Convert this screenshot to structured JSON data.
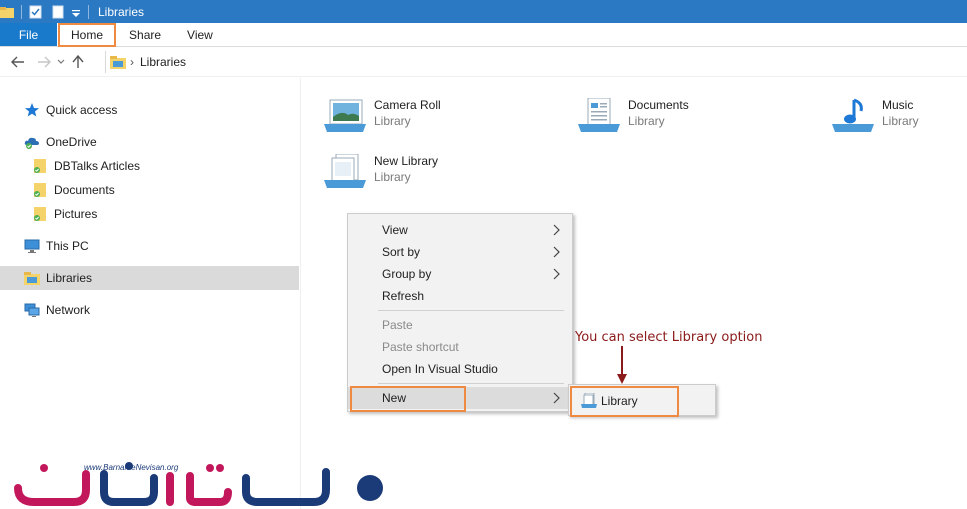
{
  "window": {
    "title": "Libraries"
  },
  "ribbon": {
    "tabs": [
      {
        "label": "File"
      },
      {
        "label": "Home"
      },
      {
        "label": "Share"
      },
      {
        "label": "View"
      }
    ]
  },
  "address": {
    "path": "Libraries"
  },
  "sidebar": {
    "items": [
      {
        "label": "Quick access",
        "icon": "star-icon"
      },
      {
        "label": "OneDrive",
        "icon": "cloud-icon"
      },
      {
        "label": "DBTalks Articles",
        "icon": "folder-icon"
      },
      {
        "label": "Documents",
        "icon": "folder-icon"
      },
      {
        "label": "Pictures",
        "icon": "folder-icon"
      },
      {
        "label": "This PC",
        "icon": "monitor-icon"
      },
      {
        "label": "Libraries",
        "icon": "library-icon"
      },
      {
        "label": "Network",
        "icon": "network-icon"
      }
    ]
  },
  "libraries": [
    {
      "name": "Camera Roll",
      "type": "Library",
      "icon": "camera-roll-library-icon"
    },
    {
      "name": "Documents",
      "type": "Library",
      "icon": "documents-library-icon"
    },
    {
      "name": "Music",
      "type": "Library",
      "icon": "music-library-icon"
    },
    {
      "name": "New Library",
      "type": "Library",
      "icon": "generic-library-icon"
    }
  ],
  "context_menu": {
    "items": [
      {
        "label": "View",
        "submenu": true
      },
      {
        "label": "Sort by",
        "submenu": true
      },
      {
        "label": "Group by",
        "submenu": true
      },
      {
        "label": "Refresh"
      },
      {
        "label": "Paste",
        "disabled": true
      },
      {
        "label": "Paste shortcut",
        "disabled": true
      },
      {
        "label": "Open In Visual Studio"
      },
      {
        "label": "New",
        "submenu": true
      }
    ],
    "submenu": {
      "label": "Library"
    }
  },
  "annotation": {
    "text": "You can select Library option"
  },
  "watermark": {
    "url": "www.BarnameNevisan.org"
  },
  "colors": {
    "accent": "#2b79c2",
    "file_tab": "#1979ca",
    "highlight": "#ef8a43",
    "annotation": "#8b1a1a"
  }
}
